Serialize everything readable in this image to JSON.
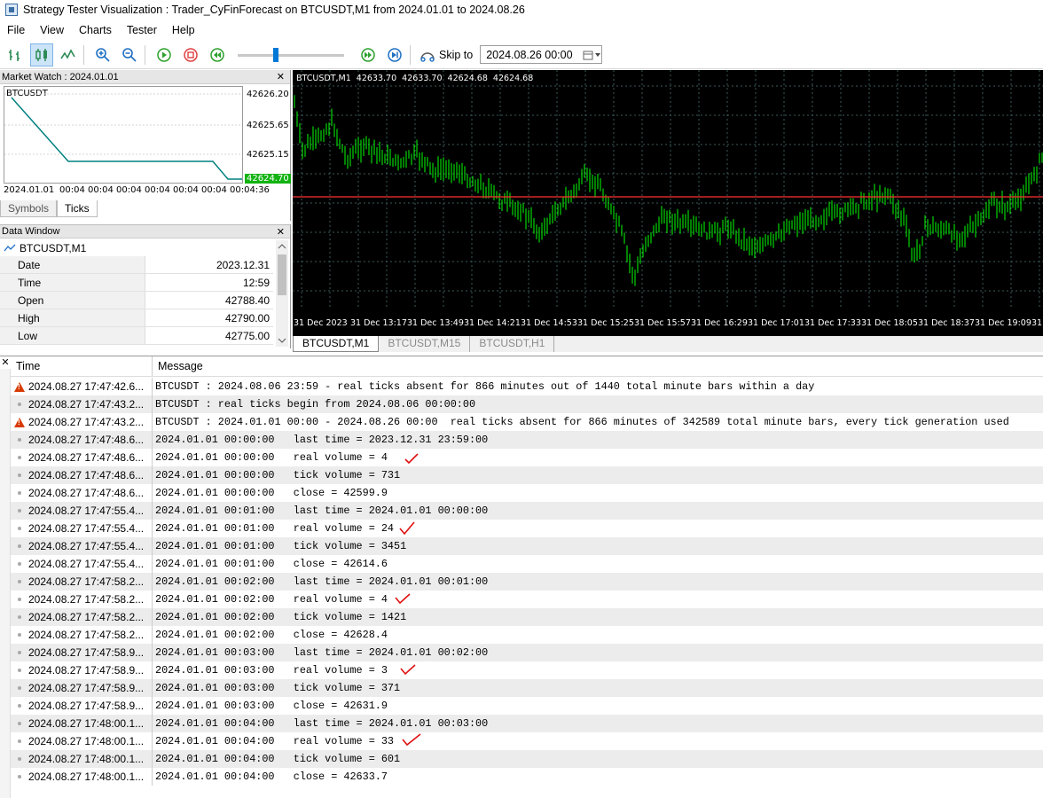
{
  "window": {
    "title": "Strategy Tester Visualization : Trader_CyFinForecast on BTCUSDT,M1 from 2024.01.01 to 2024.08.26"
  },
  "menu": [
    "File",
    "View",
    "Charts",
    "Tester",
    "Help"
  ],
  "toolbar": {
    "skip_label": "Skip to",
    "skip_value": "2024.08.26 00:00",
    "speed_level": 0.35
  },
  "market_watch": {
    "title": "Market Watch : 2024.01.01",
    "symbol": "BTCUSDT",
    "price_labels": [
      "42626.20",
      "42625.65",
      "42625.15"
    ],
    "current_price": "42624.70",
    "time_labels": [
      "2024.01.01",
      "00:04",
      "00:04",
      "00:04",
      "00:04",
      "00:04",
      "00:04",
      "00:04:36"
    ],
    "tabs": [
      "Symbols",
      "Ticks"
    ]
  },
  "data_window": {
    "title": "Data Window",
    "symbol": "BTCUSDT,M1",
    "rows": [
      {
        "k": "Date",
        "v": "2023.12.31"
      },
      {
        "k": "Time",
        "v": "12:59"
      },
      {
        "k": "Open",
        "v": "42788.40"
      },
      {
        "k": "High",
        "v": "42790.00"
      },
      {
        "k": "Low",
        "v": "42775.00"
      }
    ]
  },
  "chart": {
    "header": "BTCUSDT,M1  42633.70  42633.70  42624.68  42624.68",
    "time_labels": [
      "31 Dec 2023",
      "31 Dec 13:17",
      "31 Dec 13:49",
      "31 Dec 14:21",
      "31 Dec 14:53",
      "31 Dec 15:25",
      "31 Dec 15:57",
      "31 Dec 16:29",
      "31 Dec 17:01",
      "31 Dec 17:33",
      "31 Dec 18:05",
      "31 Dec 18:37",
      "31 Dec 19:09",
      "31"
    ],
    "tabs": [
      "BTCUSDT,M1",
      "BTCUSDT,M15",
      "BTCUSDT,H1"
    ],
    "colors": {
      "bg": "#000000",
      "candle": "#00ff00",
      "grid": "#3a5a5a",
      "level": "#ff3030"
    }
  },
  "log": {
    "headers": {
      "time": "Time",
      "message": "Message"
    },
    "rows": [
      {
        "icon": "warn",
        "time": "2024.08.27 17:47:42.6...",
        "msg": "BTCUSDT : 2024.08.06 23:59 - real ticks absent for 866 minutes out of 1440 total minute bars within a day"
      },
      {
        "icon": "dot",
        "time": "2024.08.27 17:47:43.2...",
        "msg": "BTCUSDT : real ticks begin from 2024.08.06 00:00:00"
      },
      {
        "icon": "warn",
        "time": "2024.08.27 17:47:43.2...",
        "msg": "BTCUSDT : 2024.01.01 00:00 - 2024.08.26 00:00  real ticks absent for 866 minutes of 342589 total minute bars, every tick generation used"
      },
      {
        "icon": "dot",
        "time": "2024.08.27 17:47:48.6...",
        "msg": "2024.01.01 00:00:00   last time = 2023.12.31 23:59:00"
      },
      {
        "icon": "dot",
        "time": "2024.08.27 17:47:48.6...",
        "msg": "2024.01.01 00:00:00   real volume = 4"
      },
      {
        "icon": "dot",
        "time": "2024.08.27 17:47:48.6...",
        "msg": "2024.01.01 00:00:00   tick volume = 731"
      },
      {
        "icon": "dot",
        "time": "2024.08.27 17:47:48.6...",
        "msg": "2024.01.01 00:00:00   close = 42599.9"
      },
      {
        "icon": "dot",
        "time": "2024.08.27 17:47:55.4...",
        "msg": "2024.01.01 00:01:00   last time = 2024.01.01 00:00:00"
      },
      {
        "icon": "dot",
        "time": "2024.08.27 17:47:55.4...",
        "msg": "2024.01.01 00:01:00   real volume = 24"
      },
      {
        "icon": "dot",
        "time": "2024.08.27 17:47:55.4...",
        "msg": "2024.01.01 00:01:00   tick volume = 3451"
      },
      {
        "icon": "dot",
        "time": "2024.08.27 17:47:55.4...",
        "msg": "2024.01.01 00:01:00   close = 42614.6"
      },
      {
        "icon": "dot",
        "time": "2024.08.27 17:47:58.2...",
        "msg": "2024.01.01 00:02:00   last time = 2024.01.01 00:01:00"
      },
      {
        "icon": "dot",
        "time": "2024.08.27 17:47:58.2...",
        "msg": "2024.01.01 00:02:00   real volume = 4"
      },
      {
        "icon": "dot",
        "time": "2024.08.27 17:47:58.2...",
        "msg": "2024.01.01 00:02:00   tick volume = 1421"
      },
      {
        "icon": "dot",
        "time": "2024.08.27 17:47:58.2...",
        "msg": "2024.01.01 00:02:00   close = 42628.4"
      },
      {
        "icon": "dot",
        "time": "2024.08.27 17:47:58.9...",
        "msg": "2024.01.01 00:03:00   last time = 2024.01.01 00:02:00"
      },
      {
        "icon": "dot",
        "time": "2024.08.27 17:47:58.9...",
        "msg": "2024.01.01 00:03:00   real volume = 3"
      },
      {
        "icon": "dot",
        "time": "2024.08.27 17:47:58.9...",
        "msg": "2024.01.01 00:03:00   tick volume = 371"
      },
      {
        "icon": "dot",
        "time": "2024.08.27 17:47:58.9...",
        "msg": "2024.01.01 00:03:00   close = 42631.9"
      },
      {
        "icon": "dot",
        "time": "2024.08.27 17:48:00.1...",
        "msg": "2024.01.01 00:04:00   last time = 2024.01.01 00:03:00"
      },
      {
        "icon": "dot",
        "time": "2024.08.27 17:48:00.1...",
        "msg": "2024.01.01 00:04:00   real volume = 33"
      },
      {
        "icon": "dot",
        "time": "2024.08.27 17:48:00.1...",
        "msg": "2024.01.01 00:04:00   tick volume = 601"
      },
      {
        "icon": "dot",
        "time": "2024.08.27 17:48:00.1...",
        "msg": "2024.01.01 00:04:00   close = 42633.7"
      }
    ]
  }
}
